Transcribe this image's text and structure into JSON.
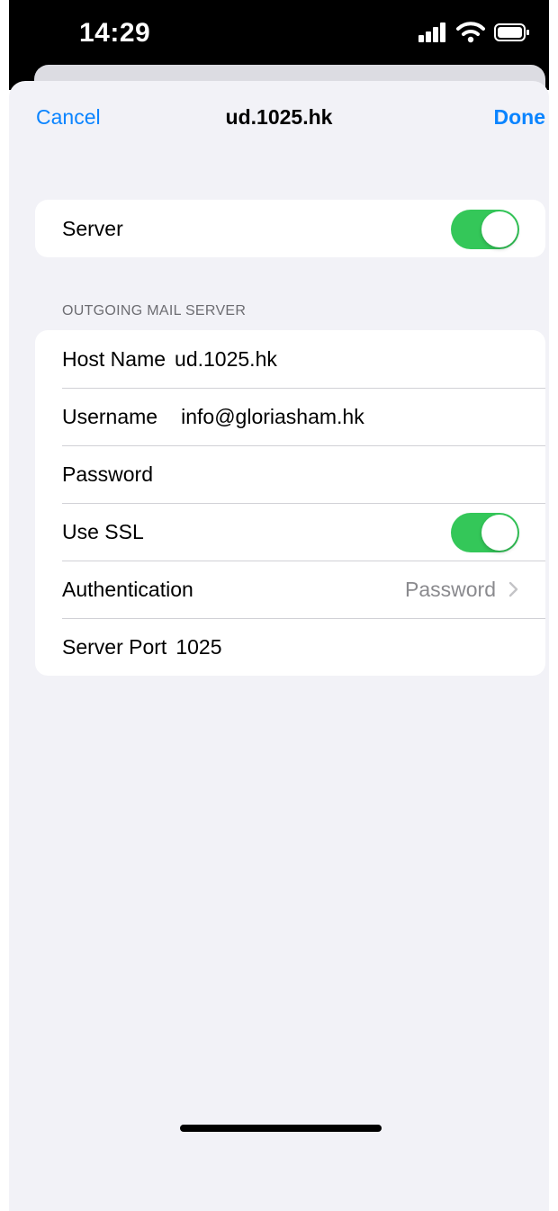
{
  "status_bar": {
    "time": "14:29"
  },
  "nav": {
    "cancel_label": "Cancel",
    "title": "ud.1025.hk",
    "done_label": "Done"
  },
  "server_toggle": {
    "label": "Server",
    "on": true
  },
  "outgoing": {
    "section_title": "OUTGOING MAIL SERVER",
    "host_label": "Host Name",
    "host_value": "ud.1025.hk",
    "username_label": "Username",
    "username_value": "info@gloriasham.hk",
    "password_label": "Password",
    "ssl_label": "Use SSL",
    "ssl_on": true,
    "auth_label": "Authentication",
    "auth_value": "Password",
    "port_label": "Server Port",
    "port_value": "1025"
  },
  "colors": {
    "accent": "#0a84ff",
    "toggle_on": "#34c759",
    "background": "#f2f2f7"
  }
}
